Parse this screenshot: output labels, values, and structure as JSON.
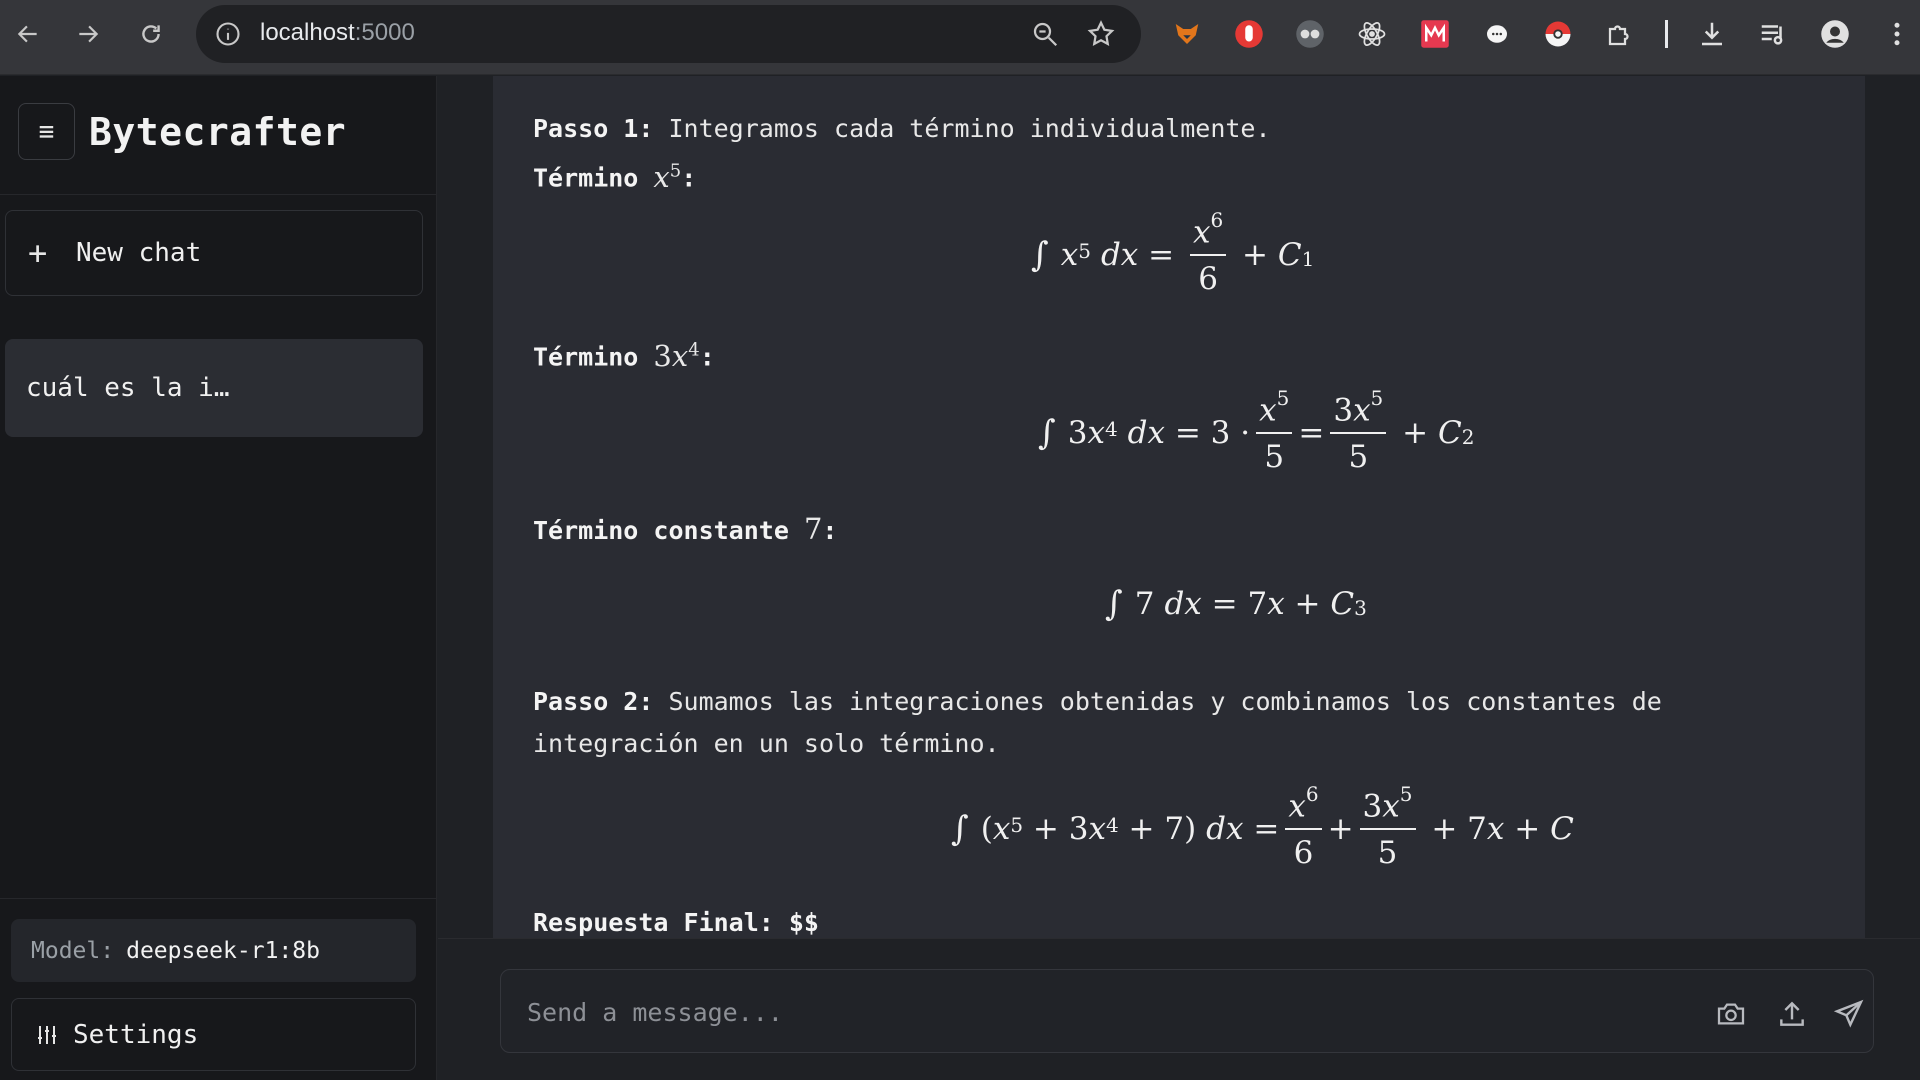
{
  "browser": {
    "url_host": "localhost",
    "url_port": ":5000"
  },
  "sidebar": {
    "brand": "Bytecrafter",
    "new_chat_label": "New chat",
    "chats": [
      {
        "title": "cuál es la i…"
      }
    ],
    "model_key": "Model:",
    "model_value": "deepseek-r1:8b",
    "settings_label": "Settings"
  },
  "message": {
    "step1_label": "Passo 1:",
    "step1_text": " Integramos cada término individualmente.",
    "term1_label": "Término ",
    "term2_label": "Término ",
    "term3_label": "Término constante ",
    "term3_value": "7",
    "step2_label": "Passo 2:",
    "step2_text_line1": " Sumamos las integraciones obtenidas y combinamos los constantes de",
    "step2_text_line2": "integración en un solo término.",
    "final_label": "Respuesta Final:",
    "final_text": " $$"
  },
  "composer": {
    "placeholder": "Send a message..."
  },
  "colors": {
    "sidebar_bg": "#17181b",
    "message_bg": "#2a2c33",
    "active_chat_bg": "#2b2d33"
  },
  "icons": [
    "back-icon",
    "forward-icon",
    "reload-icon",
    "site-info-icon",
    "zoom-icon",
    "bookmark-star-icon",
    "extension-fox-icon",
    "extension-hand-icon",
    "extension-glasses-icon",
    "extension-react-icon",
    "extension-m-icon",
    "extension-chat-icon",
    "extension-pokeball-icon",
    "extensions-puzzle-icon",
    "downloads-icon",
    "media-queue-icon",
    "profile-avatar-icon",
    "chrome-menu-icon",
    "hamburger-menu-icon",
    "plus-icon",
    "sliders-icon",
    "camera-icon",
    "upload-icon",
    "send-icon"
  ]
}
